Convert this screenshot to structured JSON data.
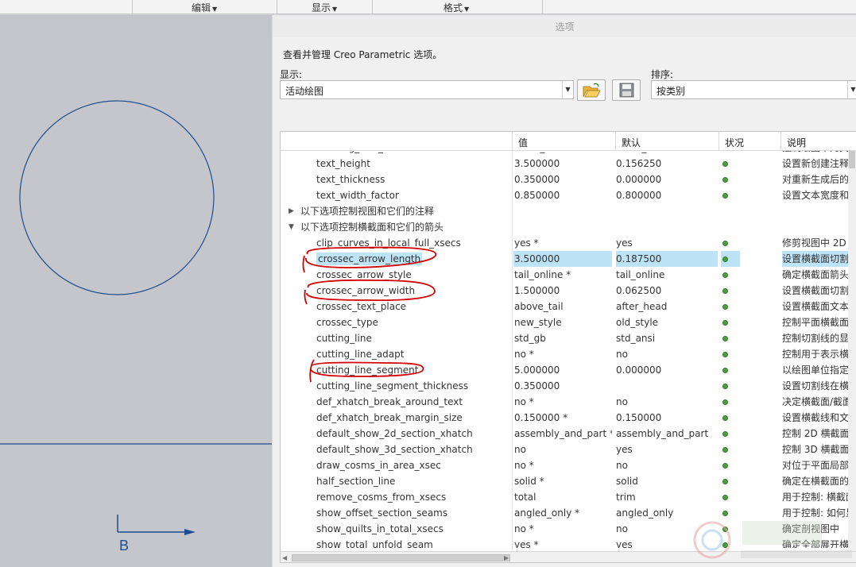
{
  "toolbar": {
    "edit": "编辑",
    "view": "显示",
    "format": "格式"
  },
  "canvas": {
    "label_b": "B"
  },
  "dialog": {
    "title": "选项",
    "description": "查看并管理 Creo Parametric 选项。",
    "show_label": "显示:",
    "show_value": "活动绘图",
    "sort_label": "排序:",
    "sort_value": "按类别",
    "open_icon": "folder-open-icon",
    "save_icon": "save-icon"
  },
  "table": {
    "headers": {
      "value": "值",
      "default": "默认",
      "status": "状况",
      "description": "说明"
    },
    "rows": [
      {
        "type": "opt",
        "name": "drawing_text_color",
        "value": "letter_color",
        "default": "letter_color",
        "desc": "控制绘图中的文"
      },
      {
        "type": "opt",
        "name": "text_height",
        "value": "3.500000",
        "default": "0.156250",
        "desc": "设置新创建注释"
      },
      {
        "type": "opt",
        "name": "text_thickness",
        "value": "0.350000",
        "default": "0.000000",
        "desc": "对重新生成后的"
      },
      {
        "type": "opt",
        "name": "text_width_factor",
        "value": "0.850000",
        "default": "0.800000",
        "desc": "设置文本宽度和"
      },
      {
        "type": "cat",
        "arrow": "▶",
        "label": "以下选项控制视图和它们的注释"
      },
      {
        "type": "cat",
        "arrow": "▼",
        "label": "以下选项控制横截面和它们的箭头"
      },
      {
        "type": "opt",
        "name": "clip_curves_in_local_full_xsecs",
        "value": "yes *",
        "default": "yes",
        "desc": "修剪视图中 2D"
      },
      {
        "type": "opt",
        "name": "crossec_arrow_length",
        "value": "3.500000",
        "default": "0.187500",
        "desc": "设置横截面切割",
        "selected": true
      },
      {
        "type": "opt",
        "name": "crossec_arrow_style",
        "value": "tail_online *",
        "default": "tail_online",
        "desc": "确定横截面箭头"
      },
      {
        "type": "opt",
        "name": "crossec_arrow_width",
        "value": "1.500000",
        "default": "0.062500",
        "desc": "设置横截面切割"
      },
      {
        "type": "opt",
        "name": "crossec_text_place",
        "value": "above_tail",
        "default": "after_head",
        "desc": "设置横截面文本"
      },
      {
        "type": "opt",
        "name": "crossec_type",
        "value": "new_style",
        "default": "old_style",
        "desc": "控制平面横截面"
      },
      {
        "type": "opt",
        "name": "cutting_line",
        "value": "std_gb",
        "default": "std_ansi",
        "desc": "控制切割线的显"
      },
      {
        "type": "opt",
        "name": "cutting_line_adapt",
        "value": "no *",
        "default": "no",
        "desc": "控制用于表示横"
      },
      {
        "type": "opt",
        "name": "cutting_line_segment",
        "value": "5.000000",
        "default": "0.000000",
        "desc": "以绘图单位指定"
      },
      {
        "type": "opt",
        "name": "cutting_line_segment_thickness",
        "value": "0.350000",
        "default": "",
        "desc": "设置切割线在横"
      },
      {
        "type": "opt",
        "name": "def_xhatch_break_around_text",
        "value": "no *",
        "default": "no",
        "desc": "决定横截面/截面"
      },
      {
        "type": "opt",
        "name": "def_xhatch_break_margin_size",
        "value": "0.150000 *",
        "default": "0.150000",
        "desc": "设置横截线和文"
      },
      {
        "type": "opt",
        "name": "default_show_2d_section_xhatch",
        "value": "assembly_and_part *",
        "default": "assembly_and_part",
        "desc": "控制 2D 横截面"
      },
      {
        "type": "opt",
        "name": "default_show_3d_section_xhatch",
        "value": "no",
        "default": "yes",
        "desc": "控制 3D 横截面"
      },
      {
        "type": "opt",
        "name": "draw_cosms_in_area_xsec",
        "value": "no *",
        "default": "no",
        "desc": "对位于平面局部"
      },
      {
        "type": "opt",
        "name": "half_section_line",
        "value": "solid *",
        "default": "solid",
        "desc": "确定在横截面的"
      },
      {
        "type": "opt",
        "name": "remove_cosms_from_xsecs",
        "value": "total",
        "default": "trim",
        "desc": "用于控制: 横截面"
      },
      {
        "type": "opt",
        "name": "show_offset_section_seams",
        "value": "angled_only *",
        "default": "angled_only",
        "desc": "用于控制: 如何显"
      },
      {
        "type": "opt",
        "name": "show_quilts_in_total_xsecs",
        "value": "no *",
        "default": "no",
        "desc": "确定剖视图中"
      },
      {
        "type": "opt",
        "name": "show_total_unfold_seam",
        "value": "yes *",
        "default": "yes",
        "desc": "确定全部展开横"
      }
    ]
  },
  "colors": {
    "selection": "#bde3f7",
    "status_dot": "#46a13a",
    "sketch_line": "#1d4d8f",
    "annotation": "#d40000"
  }
}
